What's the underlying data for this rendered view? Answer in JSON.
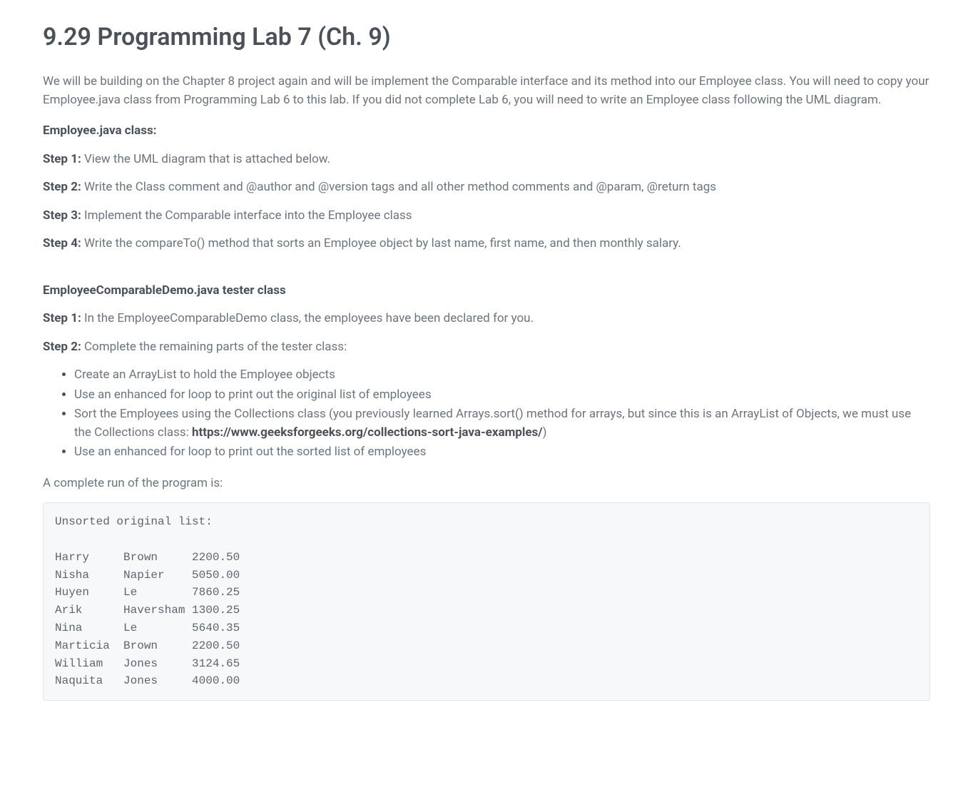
{
  "title": "9.29 Programming Lab 7 (Ch. 9)",
  "intro": "We will be building on the Chapter 8 project again and will be implement the Comparable interface and its method into our Employee class. You will need to copy your Employee.java class from Programming Lab 6 to this lab. If you did not complete Lab 6, you will need to write an Employee class following the UML diagram.",
  "section1_header": "Employee.java class:",
  "step1_label": "Step 1:",
  "step1_text": " View the UML diagram that is attached below.",
  "step2_label": "Step 2:",
  "step2_text": " Write the Class comment and @author and @version tags and all other method comments and @param, @return tags",
  "step3_label": "Step 3:",
  "step3_text": " Implement the Comparable interface into the Employee class",
  "step4_label": "Step 4:",
  "step4_text": " Write the compareTo() method that sorts an Employee object by last name, first name, and then monthly salary.",
  "section2_header": "EmployeeComparableDemo.java tester class",
  "s2_step1_label": "Step 1:",
  "s2_step1_text": " In the EmployeeComparableDemo class, the employees have been declared for you.",
  "s2_step2_label": "Step 2:",
  "s2_step2_text": " Complete the remaining parts of the tester class:",
  "bullets": {
    "b1": "Create an ArrayList to hold the Employee objects",
    "b2": "Use an enhanced for loop to print out the original list of employees",
    "b3_pre": "Sort the Employees using the Collections class (you previously learned Arrays.sort() method for arrays, but since this is an ArrayList of Objects, we must use the Collections class: ",
    "b3_link": "https://www.geeksforgeeks.org/collections-sort-java-examples/",
    "b3_post": ")",
    "b4": "Use an enhanced for loop to print out the sorted list of employees"
  },
  "run_intro": "A complete run of the program is:",
  "code_output": "Unsorted original list:\n\nHarry     Brown     2200.50\nNisha     Napier    5050.00\nHuyen     Le        7860.25\nArik      Haversham 1300.25\nNina      Le        5640.35\nMarticia  Brown     2200.50\nWilliam   Jones     3124.65\nNaquita   Jones     4000.00"
}
